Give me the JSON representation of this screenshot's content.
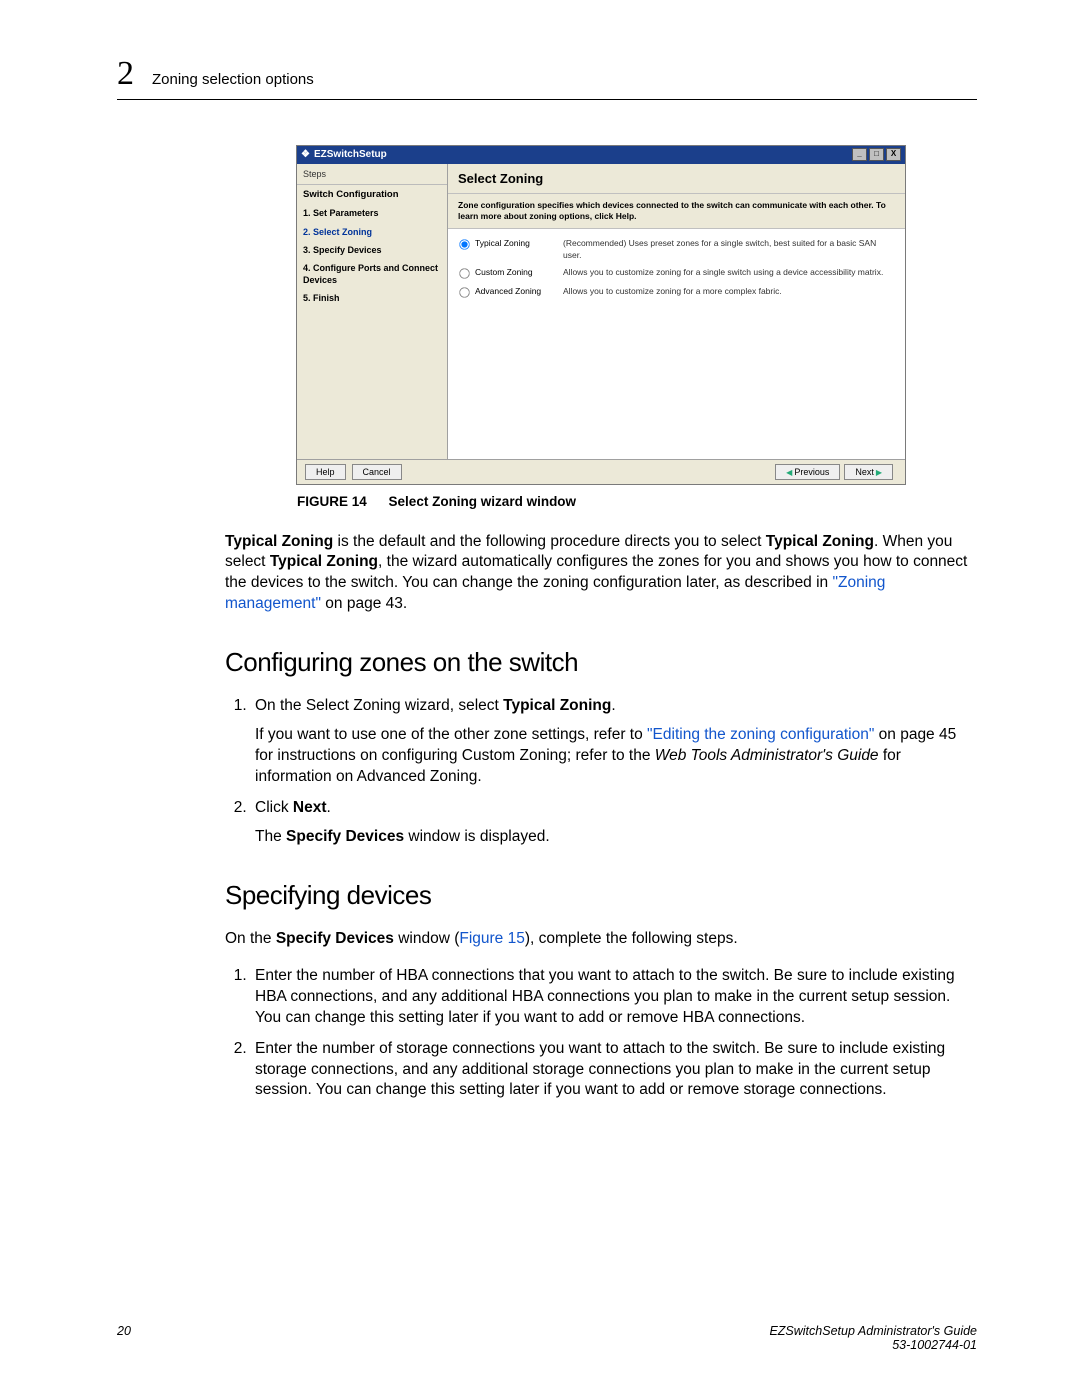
{
  "header": {
    "chapter_number": "2",
    "section_title": "Zoning selection options"
  },
  "figure": {
    "label": "FIGURE 14",
    "title": "Select Zoning wizard window",
    "window": {
      "title": "EZSwitchSetup",
      "win_min": "_",
      "win_max": "□",
      "win_close": "X",
      "sidebar": {
        "steps_label": "Steps",
        "heading": "Switch Configuration",
        "items": [
          {
            "label": "1. Set Parameters",
            "kind": "bold"
          },
          {
            "label": "2. Select Zoning",
            "kind": "current"
          },
          {
            "label": "3. Specify Devices",
            "kind": "bold"
          },
          {
            "label": "4. Configure Ports and Connect Devices",
            "kind": "bold"
          },
          {
            "label": "5. Finish",
            "kind": "bold"
          }
        ]
      },
      "main": {
        "heading": "Select Zoning",
        "description": "Zone configuration specifies which devices connected to the switch can communicate with each other. To learn more about zoning options, click Help.",
        "options": [
          {
            "name": "Typical Zoning",
            "desc": "(Recommended) Uses preset zones for a single switch, best suited for a basic SAN user.",
            "checked": true
          },
          {
            "name": "Custom Zoning",
            "desc": "Allows you to customize zoning for a single switch using a device accessibility matrix.",
            "checked": false
          },
          {
            "name": "Advanced Zoning",
            "desc": "Allows you to customize zoning for a more complex fabric.",
            "checked": false
          }
        ]
      },
      "footer": {
        "help": "Help",
        "cancel": "Cancel",
        "previous": "Previous",
        "next": "Next"
      }
    }
  },
  "body": {
    "typical_para": {
      "b1": "Typical Zoning",
      "t1": " is the default and the following procedure directs you to select ",
      "b2": "Typical Zoning",
      "t2": ". When you select ",
      "b3": "Typical Zoning",
      "t3": ", the wizard automatically configures the zones for you and shows you how to connect the devices to the switch. You can change the zoning configuration later, as described in ",
      "link": "\"Zoning management\"",
      "t4": " on page 43."
    },
    "h_configuring": "Configuring zones on the switch",
    "step1": {
      "t1": "On the Select Zoning wizard, select ",
      "b1": "Typical Zoning",
      "t2": ".",
      "sub_t1": "If you want to use one of the other zone settings, refer to ",
      "sub_link": "\"Editing the zoning configuration\"",
      "sub_t2": " on page 45 for instructions on configuring Custom Zoning; refer to the ",
      "sub_i": "Web Tools Administrator's Guide",
      "sub_t3": " for information on Advanced Zoning."
    },
    "step2": {
      "t1": "Click ",
      "b1": "Next",
      "t2": ".",
      "sub_t1": "The ",
      "sub_b1": "Specify Devices",
      "sub_t2": " window is displayed."
    },
    "h_specifying": "Specifying devices",
    "spec_intro": {
      "t1": "On the ",
      "b1": "Specify Devices",
      "t2": " window (",
      "link": "Figure 15",
      "t3": "), complete the following steps."
    },
    "spec_step1": "Enter the number of HBA connections that you want to attach to the switch. Be sure to include existing HBA connections, and any additional HBA connections you plan to make in the current setup session. You can change this setting later if you want to add or remove HBA connections.",
    "spec_step2": "Enter the number of storage connections you want to attach to the switch. Be sure to include existing storage connections, and any additional storage connections you plan to make in the current setup session. You can change this setting later if you want to add or remove storage connections."
  },
  "footer": {
    "page": "20",
    "doc_title": "EZSwitchSetup Administrator's Guide",
    "doc_id": "53-1002744-01"
  }
}
